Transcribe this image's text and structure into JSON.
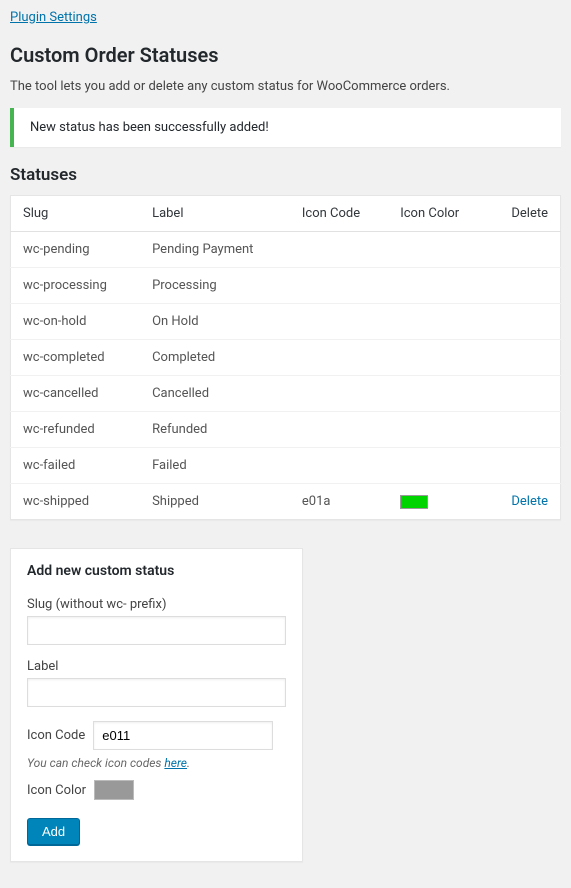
{
  "topLink": "Plugin Settings",
  "pageTitle": "Custom Order Statuses",
  "description": "The tool lets you add or delete any custom status for WooCommerce orders.",
  "notice": "New status has been successfully added!",
  "statusesHeading": "Statuses",
  "table": {
    "headers": {
      "slug": "Slug",
      "label": "Label",
      "iconCode": "Icon Code",
      "iconColor": "Icon Color",
      "delete": "Delete"
    },
    "rows": [
      {
        "slug": "wc-pending",
        "label": "Pending Payment",
        "iconCode": "",
        "iconColor": "",
        "delete": ""
      },
      {
        "slug": "wc-processing",
        "label": "Processing",
        "iconCode": "",
        "iconColor": "",
        "delete": ""
      },
      {
        "slug": "wc-on-hold",
        "label": "On Hold",
        "iconCode": "",
        "iconColor": "",
        "delete": ""
      },
      {
        "slug": "wc-completed",
        "label": "Completed",
        "iconCode": "",
        "iconColor": "",
        "delete": ""
      },
      {
        "slug": "wc-cancelled",
        "label": "Cancelled",
        "iconCode": "",
        "iconColor": "",
        "delete": ""
      },
      {
        "slug": "wc-refunded",
        "label": "Refunded",
        "iconCode": "",
        "iconColor": "",
        "delete": ""
      },
      {
        "slug": "wc-failed",
        "label": "Failed",
        "iconCode": "",
        "iconColor": "",
        "delete": ""
      },
      {
        "slug": "wc-shipped",
        "label": "Shipped",
        "iconCode": "e01a",
        "iconColor": "#00d400",
        "delete": "Delete"
      }
    ]
  },
  "form": {
    "heading": "Add new custom status",
    "slugLabel": "Slug (without wc- prefix)",
    "slugValue": "",
    "labelLabel": "Label",
    "labelValue": "",
    "iconCodeLabel": "Icon Code",
    "iconCodeValue": "e011",
    "helperPrefix": "You can check icon codes ",
    "helperLink": "here",
    "helperSuffix": ".",
    "iconColorLabel": "Icon Color",
    "iconColorValue": "#999999",
    "submitLabel": "Add"
  }
}
